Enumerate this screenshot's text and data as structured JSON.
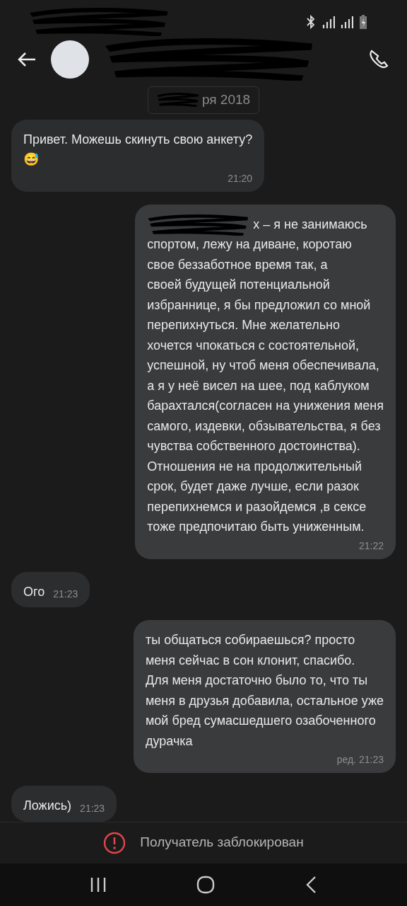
{
  "date_chip": "ря 2018",
  "messages": [
    {
      "kind": "incoming",
      "text": "Привет. Можешь скинуть свою анкету?\n😅",
      "time": "21:20"
    },
    {
      "kind": "outgoing",
      "redacted_start": true,
      "text": "х – я не занимаюсь\nспортом, лежу на диване, коротаю\nсвое беззаботное время так, а\nсвоей будущей потенциальной\nизбраннице, я бы предложил со мной\nперепихнуться. Мне желательно\nхочется чпокаться с состоятельной,\nуспешной, ну чтоб меня обеспечивала,\nа я у неё висел на шее, под каблуком\nбарахтался(согласен на унижения меня\nсамого, издевки, обзывательства, я без\nчувства собственного достоинства).\nОтношения не на продолжительный\nсрок, будет даже лучше, если разок\nперепихнемся и разойдемся ,в сексе\nтоже предпочитаю быть униженным.",
      "time": "21:22"
    },
    {
      "kind": "incoming",
      "text": "Ого",
      "time": "21:23"
    },
    {
      "kind": "outgoing",
      "text": "ты общаться собираешься? просто\nменя сейчас в сон клонит, спасибо.\nДля меня достаточно было то, что ты\nменя в друзья добавила, остальное уже\nмой бред сумасшедшего озабоченного\nдурачка",
      "edited": "ред.",
      "time": "21:23"
    },
    {
      "kind": "incoming",
      "text": "Ложись)",
      "time": "21:23"
    }
  ],
  "blocked_notice": "Получатель заблокирован"
}
